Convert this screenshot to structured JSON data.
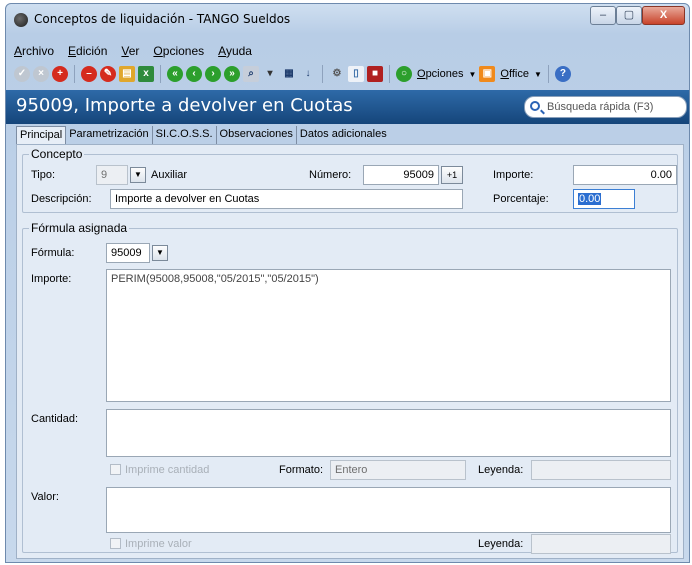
{
  "window": {
    "title": "Conceptos de liquidación - TANGO Sueldos",
    "min_label": "–",
    "max_label": "▢",
    "close_label": "X"
  },
  "menu": [
    "Archivo",
    "Edición",
    "Ver",
    "Opciones",
    "Ayuda"
  ],
  "toolbar": {
    "opciones_label": "Opciones",
    "office_label": "Office",
    "icons": [
      "check-icon",
      "cancel-icon",
      "add-icon",
      "delete-icon",
      "edit-icon",
      "print-icon",
      "excel-icon",
      "first-icon",
      "previous-icon",
      "next-icon",
      "last-icon",
      "search-records-icon",
      "filter-icon",
      "columns-icon",
      "sort-icon",
      "config-icon",
      "preview-icon",
      "export-icon",
      "options-icon",
      "office-icon",
      "help-icon"
    ]
  },
  "header": {
    "title": "95009, Importe a devolver en Cuotas",
    "search_placeholder": "Búsqueda rápida (F3)"
  },
  "tabs": [
    "Principal",
    "Parametrización",
    "SI.C.O.S.S.",
    "Observaciones",
    "Datos adicionales"
  ],
  "concepto": {
    "legend": "Concepto",
    "tipo_label": "Tipo:",
    "tipo_value": "9",
    "tipo_desc": "Auxiliar",
    "numero_label": "Número:",
    "numero_value": "95009",
    "calc_label": "+1",
    "importe_label": "Importe:",
    "importe_value": "0.00",
    "descripcion_label": "Descripción:",
    "descripcion_value": "Importe a devolver en Cuotas",
    "porcentaje_label": "Porcentaje:",
    "porcentaje_value": "0.00"
  },
  "formula": {
    "legend": "Fórmula asignada",
    "formula_label": "Fórmula:",
    "formula_value": "95009",
    "importe_label": "Importe:",
    "importe_expr": "PERIM(95008,95008,\"05/2015\",\"05/2015\")",
    "cantidad_label": "Cantidad:",
    "imprime_cantidad_label": "Imprime cantidad",
    "formato_label": "Formato:",
    "formato_value": "Entero",
    "leyenda_label": "Leyenda:",
    "valor_label": "Valor:",
    "imprime_valor_label": "Imprime valor",
    "leyenda2_label": "Leyenda:"
  },
  "colors": {
    "header_band": "#1f5796",
    "panel_bg": "#e3ebf5",
    "selection": "#2b6ed0"
  }
}
